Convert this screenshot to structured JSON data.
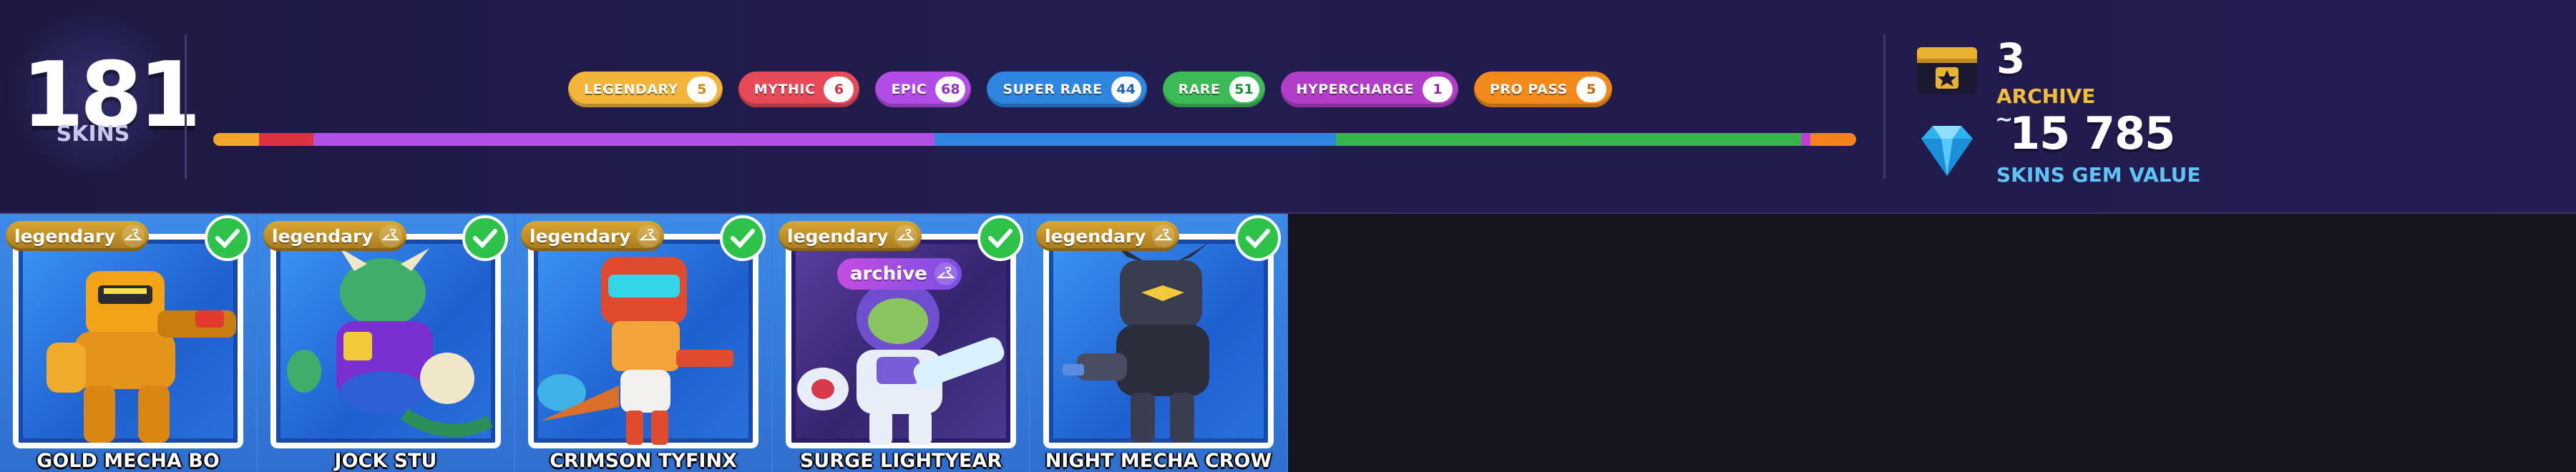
{
  "summary": {
    "total_skins": "181",
    "total_label": "SKINS"
  },
  "rarities": [
    {
      "label": "LEGENDARY",
      "count": "5",
      "color": "#f2b53a",
      "count_color": "#c98a10"
    },
    {
      "label": "MYTHIC",
      "count": "6",
      "color": "#e64a57",
      "count_color": "#d22e3c"
    },
    {
      "label": "EPIC",
      "count": "68",
      "color": "#b24ce6",
      "count_color": "#8e2fc4"
    },
    {
      "label": "SUPER RARE",
      "count": "44",
      "color": "#2f86e0",
      "count_color": "#1c66bd"
    },
    {
      "label": "RARE",
      "count": "51",
      "color": "#3bbb55",
      "count_color": "#1f8f36"
    },
    {
      "label": "HYPERCHARGE",
      "count": "1",
      "color": "#b23ec7",
      "count_color": "#8a2aa2"
    },
    {
      "label": "PRO PASS",
      "count": "5",
      "color": "#f28a1b",
      "count_color": "#c56708"
    }
  ],
  "rarity_bar": [
    {
      "name": "legendary",
      "share": 5,
      "color": "#f2a62b"
    },
    {
      "name": "mythic",
      "share": 6,
      "color": "#dd3340"
    },
    {
      "name": "epic",
      "share": 68,
      "color": "#b14fe6"
    },
    {
      "name": "super-rare",
      "share": 44,
      "color": "#2f86e0"
    },
    {
      "name": "rare",
      "share": 51,
      "color": "#36b54a"
    },
    {
      "name": "hypercharge",
      "share": 1,
      "color": "#c13ed6"
    },
    {
      "name": "pro-pass",
      "share": 5,
      "color": "#f5821a"
    }
  ],
  "archive": {
    "count": "3",
    "label": "ARCHIVE"
  },
  "gem_value": {
    "approx": "~",
    "value": "15 785",
    "label": "SKINS GEM VALUE"
  },
  "cards": [
    {
      "name": "GOLD MECHA BO",
      "rarity": "legendary",
      "archive": false,
      "art_color": "#f2a318"
    },
    {
      "name": "JOCK STU",
      "rarity": "legendary",
      "archive": false,
      "art_color": "#3fae6a"
    },
    {
      "name": "CRIMSON TYFINX",
      "rarity": "legendary",
      "archive": false,
      "art_color": "#e04b2e"
    },
    {
      "name": "SURGE LIGHTYEAR",
      "rarity": "legendary",
      "archive": true,
      "archive_label": "archive",
      "art_color": "#e8eef8"
    },
    {
      "name": "NIGHT MECHA CROW",
      "rarity": "legendary",
      "archive": false,
      "art_color": "#3a3d4f"
    }
  ]
}
